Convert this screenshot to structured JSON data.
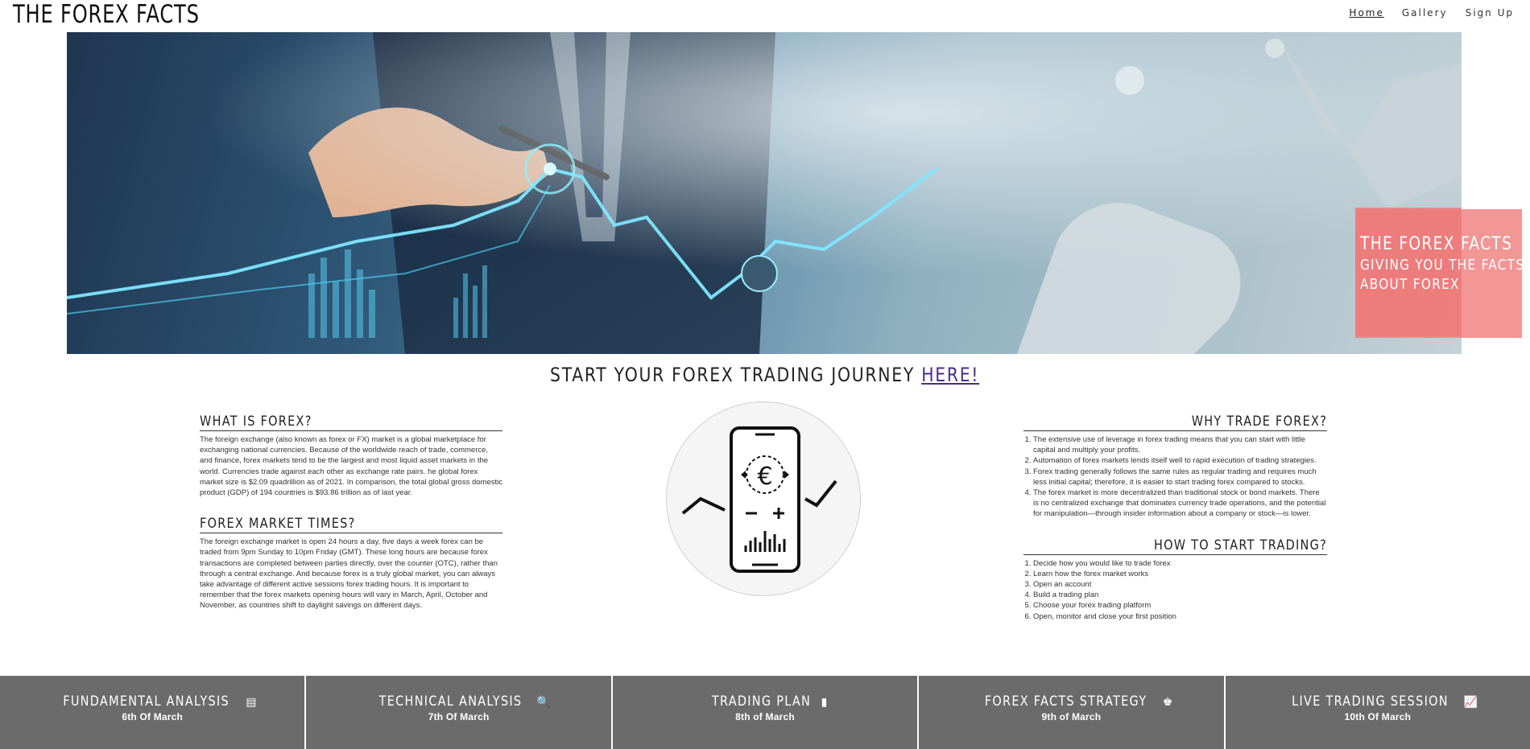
{
  "site": {
    "brand": "THE FOREX FACTS"
  },
  "nav": {
    "items": [
      "Home",
      "Gallery",
      "Sign Up"
    ]
  },
  "hero": {
    "overlay_title": "THE FOREX FACTS",
    "overlay_subtitle_1": "GIVING YOU THE FACTS",
    "overlay_subtitle_2": "ABOUT FOREX"
  },
  "cta": {
    "text": "START YOUR FOREX TRADING JOURNEY ",
    "link": "HERE!"
  },
  "left": {
    "what_title": "WHAT IS FOREX?",
    "what_body": "The foreign exchange (also known as forex or FX) market is a global marketplace for exchanging national currencies. Because of the worldwide reach of trade, commerce, and finance, forex markets tend to be the largest and most liquid asset markets in the world. Currencies trade against each other as exchange rate pairs. he global forex market size is $2.09 quadrillion as of 2021. In comparison, the total global gross domestic product (GDP) of 194 countries is $93.86 trillion as of last year.",
    "times_title": "FOREX MARKET TIMES?",
    "times_body": "The foreign exchange market is open 24 hours a day, five days a week forex can be traded from 9pm Sunday to 10pm Friday (GMT). These long hours are because forex transactions are completed between parties directly, over the counter (OTC), rather than through a central exchange. And because forex is a truly global market, you can always take advantage of different active sessions forex trading hours. It is important to remember that the forex markets opening hours will vary in March, April, October and November, as countries shift to daylight savings on different days."
  },
  "right": {
    "why_title": "WHY TRADE FOREX?",
    "why_items": [
      "The extensive use of leverage in forex trading means that you can start with little capital and multiply your profits.",
      "Automation of forex markets lends itself well to rapid execution of trading strategies.",
      "Forex trading generally follows the same rules as regular trading and requires much less initial capital; therefore, it is easier to start trading forex compared to stocks.",
      "The forex market is more decentralized than traditional stock or bond markets. There is no centralized exchange that dominates currency trade operations, and the potential for manipulation—through insider information about a company or stock—is lower."
    ],
    "how_title": "HOW TO START TRADING?",
    "how_items": [
      "Decide how you would like to trade forex",
      "Learn how the forex market works",
      "Open an account",
      "Build a trading plan",
      "Choose your forex trading platform",
      "Open, monitor and close your first position"
    ]
  },
  "tiles": [
    {
      "title": "FUNDAMENTAL ANALYSIS",
      "icon": "newspaper-icon",
      "glyph": "▤",
      "date": "6th Of March"
    },
    {
      "title": "TECHNICAL ANALYSIS",
      "icon": "search-icon",
      "glyph": "🔍",
      "date": "7th Of March"
    },
    {
      "title": "TRADING PLAN",
      "icon": "book-icon",
      "glyph": "▮",
      "date": "8th of March"
    },
    {
      "title": "FOREX FACTS STRATEGY",
      "icon": "chess-icon",
      "glyph": "♚",
      "date": "9th of March"
    },
    {
      "title": "LIVE TRADING SESSION",
      "icon": "chart-line-icon",
      "glyph": "📈",
      "date": "10th Of March"
    }
  ]
}
